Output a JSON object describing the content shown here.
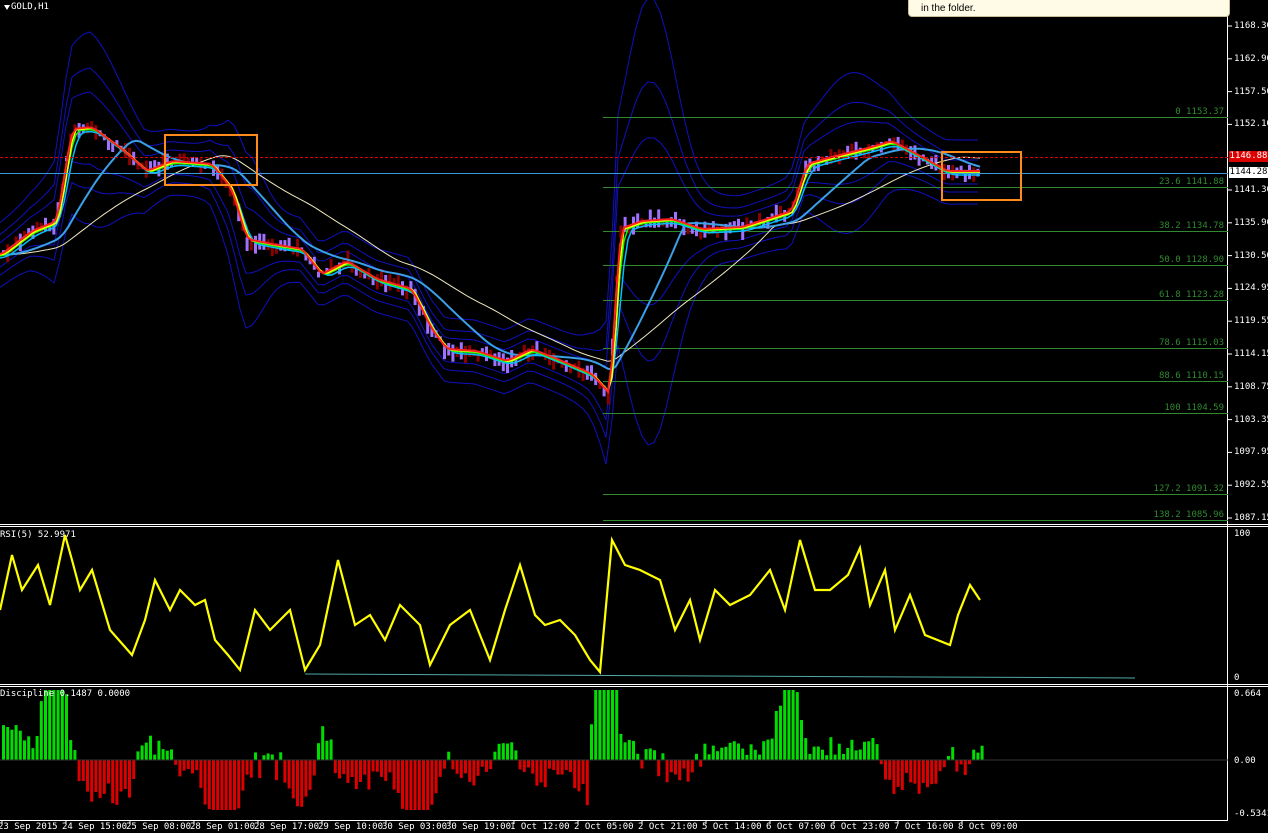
{
  "chart": {
    "symbol": "GOLD,H1",
    "current_price": "1144.28",
    "bid_line_price": "1146.88",
    "y_ticks": [
      "1168.30",
      "1162.90",
      "1157.50",
      "1152.10",
      "1146.88",
      "1141.30",
      "1135.90",
      "1130.50",
      "1124.95",
      "1119.55",
      "1114.15",
      "1108.75",
      "1103.35",
      "1097.95",
      "1092.55",
      "1087.15"
    ],
    "fib_levels": [
      {
        "label": "0 1153.37"
      },
      {
        "label": "23.6 1141.88"
      },
      {
        "label": "38.2 1134.78"
      },
      {
        "label": "50.0 1128.90"
      },
      {
        "label": "61.8 1123.28"
      },
      {
        "label": "78.6 1115.03"
      },
      {
        "label": "88.6 1110.15"
      },
      {
        "label": "100 1104.59"
      },
      {
        "label": "127.2 1091.32"
      },
      {
        "label": "138.2 1085.96"
      }
    ],
    "x_ticks": [
      "23 Sep 2015",
      "24 Sep 15:00",
      "25 Sep 08:00",
      "28 Sep 01:00",
      "28 Sep 17:00",
      "29 Sep 10:00",
      "30 Sep 03:00",
      "30 Sep 19:00",
      "1 Oct 12:00",
      "2 Oct 05:00",
      "2 Oct 21:00",
      "5 Oct 14:00",
      "6 Oct 07:00",
      "6 Oct 23:00",
      "7 Oct 16:00",
      "8 Oct 09:00"
    ]
  },
  "rsi": {
    "title": "RSI(5) 52.9971",
    "levels": [
      "100",
      "0"
    ]
  },
  "discipline": {
    "title": "Discipline 0.1487 0.0000",
    "levels": [
      "0.664",
      "0.00",
      "-0.5341"
    ]
  },
  "tooltip": {
    "text": "in the folder."
  },
  "colors": {
    "up_bar": "#00dd00",
    "down_bar": "#dd0000",
    "rsi_line": "#ffff00",
    "bands": "#1010c0",
    "fib": "#2f8a2f",
    "highlight": "#ff8c1a"
  }
}
